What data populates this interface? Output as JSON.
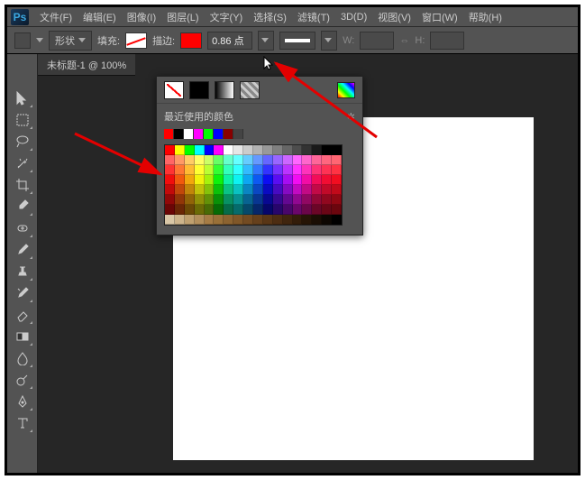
{
  "app": {
    "logo_text": "Ps"
  },
  "menu": {
    "file": "文件(F)",
    "edit": "编辑(E)",
    "image": "图像(I)",
    "layer": "图层(L)",
    "type": "文字(Y)",
    "select": "选择(S)",
    "filter": "滤镜(T)",
    "threeD": "3D(D)",
    "view": "视图(V)",
    "window": "窗口(W)",
    "help": "帮助(H)"
  },
  "options": {
    "shape_label": "形状",
    "fill_label": "填充:",
    "stroke_label": "描边:",
    "stroke_width": "0.86 点",
    "width_label": "W:",
    "height_label": "H:",
    "fill_color": "#ffffff",
    "stroke_color": "#ff0000"
  },
  "tab": {
    "title": "未标题-1 @ 100%"
  },
  "popup": {
    "title": "最近使用的颜色",
    "gear": "✲",
    "recent": [
      "#ff0000",
      "#000000",
      "#ffffff",
      "#ff00ff",
      "#00ff00",
      "#0000ff",
      "#880000",
      "#444444"
    ]
  },
  "tools": {
    "move": "move",
    "marquee": "marquee",
    "lasso": "lasso",
    "wand": "wand",
    "crop": "crop",
    "eyedrop": "eyedrop",
    "heal": "heal",
    "brush": "brush",
    "stamp": "stamp",
    "history": "history",
    "eraser": "eraser",
    "gradient": "gradient",
    "blur": "blur",
    "dodge": "dodge",
    "pen": "pen",
    "text": "text"
  }
}
